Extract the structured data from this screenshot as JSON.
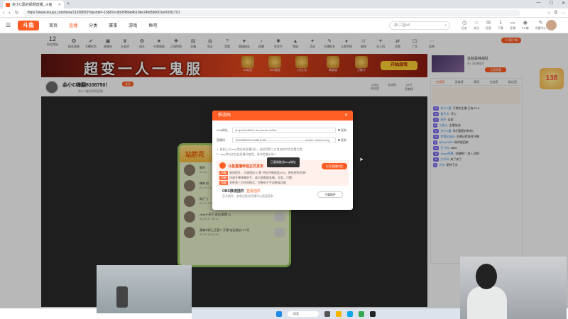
{
  "browser": {
    "tab_title": "余小C嘉的视频直播_斗鱼",
    "url": "https://www.douyu.com/beta/11208650?dyshid=-16b87e-bb05f8bd4610be24bf3b6601e00091701",
    "controls": [
      "—",
      "☐",
      "✕"
    ]
  },
  "site": {
    "logo": "斗鱼",
    "nav": [
      "首页",
      "直播",
      "分类",
      "赛事",
      "游戏",
      "鱼吧"
    ],
    "search_placeholder": "搜:三国kill",
    "header_icons": [
      {
        "glyph": "◷",
        "label": "历史"
      },
      {
        "glyph": "☆",
        "label": "关注"
      },
      {
        "glyph": "✉",
        "label": "信息"
      },
      {
        "glyph": "⇩",
        "label": "下载"
      },
      {
        "glyph": "▭",
        "label": "开播"
      },
      {
        "glyph": "◉",
        "label": "PC端"
      },
      {
        "glyph": "✎",
        "label": "充值中心"
      }
    ]
  },
  "category_bar": {
    "level_num": "12",
    "level_label": "粉丝等级",
    "items": [
      "粉丝勋章",
      "主播任务",
      "直播间",
      "水友杯",
      "送礼",
      "礼物周星",
      "订阅特权",
      "宝箱",
      "鱼丸",
      "竞猜",
      "超级粉丝",
      "提醒",
      "狂欢节",
      "等级",
      "活动",
      "主播报名",
      "斗鱼特权",
      "星粉",
      "无人机",
      "兑换",
      "广告",
      "菜单"
    ],
    "pc_button": "PC客户端"
  },
  "banner": {
    "title": "超变一人一鬼服",
    "gifts": [
      "2w钻石",
      "500鼓励",
      "1元红包",
      "高级锁",
      "万能卡"
    ],
    "start_button": "开始游戏"
  },
  "promo": {
    "title": "这就是特战队",
    "subtitle": "热门直播推荐",
    "button": "立即观看"
  },
  "side_badge": "138",
  "streamer": {
    "title": "余小C嗨翻6108750！",
    "follow": "关注",
    "sub": "余小C嘉的视频直播",
    "stats": [
      {
        "num": "1/300",
        "label": "粉丝团"
      },
      {
        "num": "全站榜",
        "label": ""
      },
      {
        "num": "20分",
        "label": "贡献榜"
      }
    ]
  },
  "stream_card": {
    "title": "站防花",
    "rows": [
      {
        "name": "那阿",
        "time": "05-29"
      },
      {
        "name": "微每 俗",
        "time": "05-29 23:38:28"
      },
      {
        "name": "陈汇飞",
        "time": "05-29 19:09:26"
      },
      {
        "name": "chair小声子 送出 邮票 x1",
        "time": "05-29 17:48:12"
      },
      {
        "name": "竟嘛车掉上正营人 开通 钻石粉丝x1个月",
        "time": "05-29 16:44:59"
      }
    ]
  },
  "chat": {
    "tabs": [
      "在线榜",
      "贡献榜",
      "周榜",
      "全站榜",
      "粉丝团"
    ],
    "messages": [
      {
        "lv": "25",
        "user": "余小C嘉",
        "text": "不错的主播 已有XX人"
      },
      {
        "lv": "19",
        "user": "看今天",
        "text": "开心"
      },
      {
        "lv": "12",
        "user": "顺手",
        "text": "走起"
      },
      {
        "lv": "8",
        "user": "小鱼儿",
        "text": "主播加油"
      },
      {
        "lv": "17",
        "user": "余小C嘉",
        "text": "你们都是好样的!"
      },
      {
        "lv": "30",
        "user": "梦落花流水",
        "text": "主播记得准时开播"
      },
      {
        "lv": "6",
        "user": "@9ay2848",
        "text": "啥时候回来"
      },
      {
        "lv": "22",
        "user": "天飞鸟",
        "text": "6666"
      },
      {
        "lv": "15",
        "user": "Angel落幕",
        "text": "\"蛇麟科\" \"身入可期\""
      },
      {
        "lv": "11",
        "user": "大华码",
        "text": "来了来了"
      },
      {
        "lv": "9",
        "user": "大华",
        "text": "期待下次"
      }
    ]
  },
  "modal": {
    "title": "推流码",
    "rtmp_label": "rtmp地址",
    "rtmp_value": "rtmp://sendfire1.douyucdn.cn/live",
    "stream_label": "直播码",
    "stream_value": "11208650rDGUdB1Kr9th-----------------------------------------wcsid=-fcdsrvrecog",
    "copy": "复制",
    "note1": "1. 复制上方rtmp地址和直播码后，粘贴到第三方推流软件的设置位置",
    "note2": "2. rtmp地址仅在此直播间使用，请勿泄露给他人",
    "warn_title": "斗鱼直播伴侣正式发布",
    "open_button": "打开直播伴侣",
    "warn_lines": [
      {
        "tag": "功能",
        "text": "画质提升，大幅增加\"斗鱼\"特权开播速度20%，降低更多资源!"
      },
      {
        "tag": "功能",
        "text": "快速开播弹幕助手，放大图数据准确，全面，可靠!"
      },
      {
        "tag": "功能",
        "text": "多种第三方特效模式，完善电子手动数据功能"
      }
    ],
    "obs_title": "OBS推流插件",
    "obs_link": "查看插件",
    "obs_sub": "官方插件，安装后推流开播可以直接获取",
    "download_button": "下载插件",
    "close": "✕"
  },
  "tooltip": "已复制推流rtmp地址",
  "taskbar": {
    "search": "搜索"
  }
}
